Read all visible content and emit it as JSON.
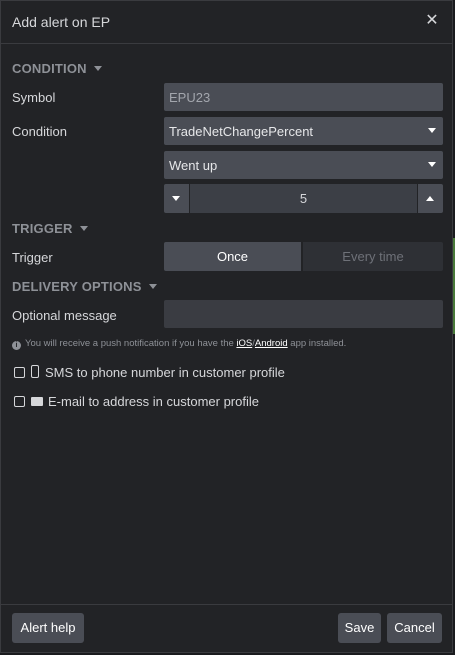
{
  "dialog": {
    "title": "Add alert on EP",
    "close_glyph": "✕"
  },
  "condition_section": {
    "title": "CONDITION",
    "symbol_label": "Symbol",
    "symbol_value": "EPU23",
    "condition_label": "Condition",
    "condition_value": "TradeNetChangePercent",
    "direction_value": "Went up",
    "threshold_value": "5"
  },
  "trigger_section": {
    "title": "TRIGGER",
    "trigger_label": "Trigger",
    "options": [
      "Once",
      "Every time"
    ],
    "selected": "Once"
  },
  "delivery_section": {
    "title": "DELIVERY OPTIONS",
    "message_label": "Optional message",
    "message_value": "",
    "info_prefix": "You will receive a push notification if you have the",
    "info_ios": "iOS",
    "info_sep": "/",
    "info_android": "Android",
    "info_suffix": "app installed.",
    "sms_label": "SMS to phone number in customer profile",
    "sms_checked": false,
    "email_label": "E-mail to address in customer profile",
    "email_checked": false
  },
  "footer": {
    "help_label": "Alert help",
    "save_label": "Save",
    "cancel_label": "Cancel"
  },
  "icons": {
    "close": "close-icon",
    "info": "info-icon",
    "phone": "mobile-phone-icon",
    "mail": "envelope-icon",
    "caret": "chevron-down-icon"
  },
  "colors": {
    "dialog_bg": "#222326",
    "field_bg": "#4a4d55",
    "section_title": "#8e9197",
    "text": "#d6d7da"
  }
}
